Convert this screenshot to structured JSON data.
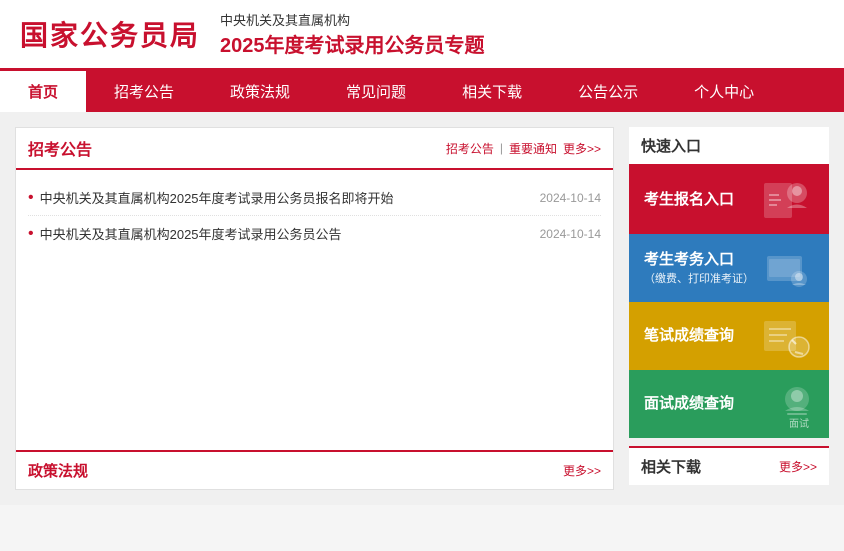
{
  "header": {
    "logo": "国家公务员局",
    "subtitle": "中央机关及其直属机构",
    "title": "2025年度考试录用公务员专题"
  },
  "nav": {
    "items": [
      {
        "label": "首页",
        "active": true
      },
      {
        "label": "招考公告",
        "active": false
      },
      {
        "label": "政策法规",
        "active": false
      },
      {
        "label": "常见问题",
        "active": false
      },
      {
        "label": "相关下载",
        "active": false
      },
      {
        "label": "公告公示",
        "active": false
      },
      {
        "label": "个人中心",
        "active": false
      }
    ]
  },
  "announcement": {
    "title": "招考公告",
    "links": [
      "招考公告",
      "重要通知",
      "更多>>"
    ],
    "news": [
      {
        "title": "中央机关及其直属机构2025年度考试录用公务员报名即将开始",
        "date": "2024-10-14"
      },
      {
        "title": "中央机关及其直属机构2025年度考试录用公务员公告",
        "date": "2024-10-14"
      }
    ]
  },
  "quick_access": {
    "title": "快速入口",
    "buttons": [
      {
        "label": "考生报名入口",
        "sub": "",
        "color": "red"
      },
      {
        "label": "考生考务入口",
        "sub": "（缴费、打印准考证）",
        "color": "blue"
      },
      {
        "label": "笔试成绩查询",
        "sub": "",
        "color": "gold"
      },
      {
        "label": "面试成绩查询",
        "sub": "",
        "color": "green"
      }
    ]
  },
  "policy": {
    "title": "政策法规",
    "more": "更多>>"
  },
  "download": {
    "title": "相关下载",
    "more": "更多>>"
  }
}
